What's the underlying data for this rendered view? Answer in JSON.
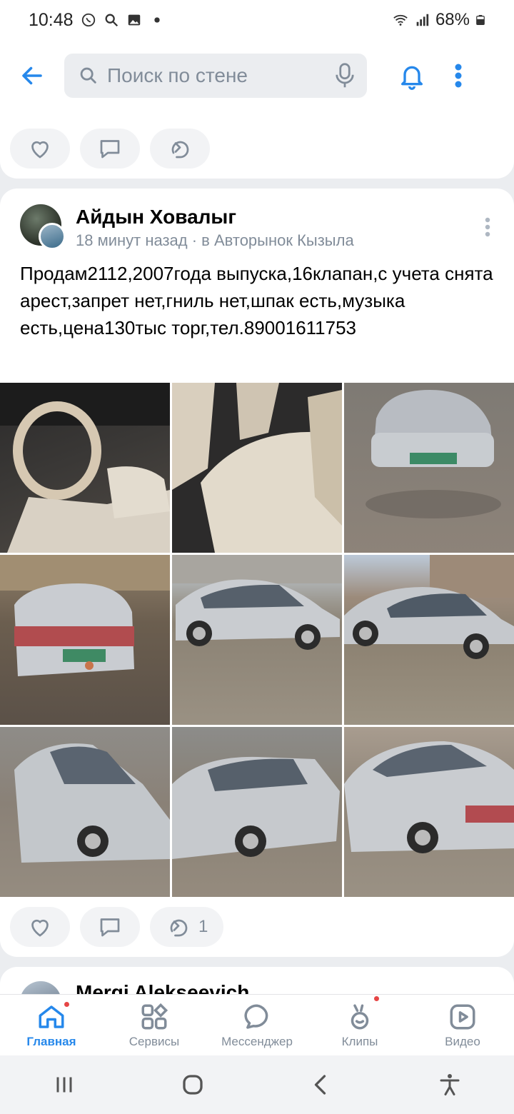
{
  "status": {
    "time": "10:48",
    "battery": "68%"
  },
  "header": {
    "search_placeholder": "Поиск по стене"
  },
  "post": {
    "author": "Айдын Ховалыг",
    "meta": "18 минут назад · в Авторынок Кызыла",
    "text": "Продам2112,2007года выпуска,16клапан,с учета снята арест,запрет нет,гниль нет,шпак есть,музыка есть,цена130тыс торг,тел.89001611753",
    "photo_count": 9,
    "repost_count": "1"
  },
  "next_post": {
    "author": "Mergi Alekseevich"
  },
  "bottom_nav": [
    {
      "label": "Главная",
      "active": true
    },
    {
      "label": "Сервисы",
      "active": false
    },
    {
      "label": "Мессенджер",
      "active": false
    },
    {
      "label": "Клипы",
      "active": false
    },
    {
      "label": "Видео",
      "active": false
    }
  ],
  "colors": {
    "accent": "#2688eb",
    "secondary_text": "#818c99",
    "background": "#ebedf0",
    "badge": "#e64646"
  }
}
